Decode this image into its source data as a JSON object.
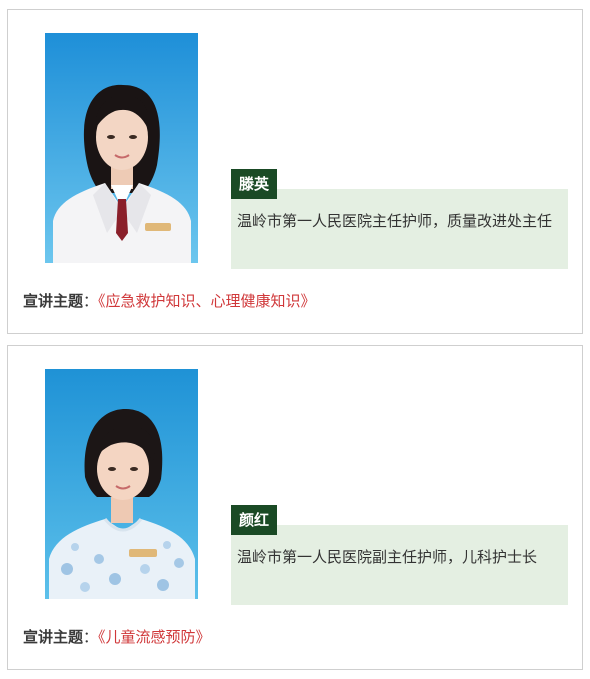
{
  "speakers": [
    {
      "photo_icon": "portrait-nurse-icon",
      "name": "滕英",
      "title": "温岭市第一人民医院主任护师，质量改进处主任",
      "topic_label": "宣讲主题",
      "topic_colon": "：",
      "topic": "《应急救护知识、心理健康知识》"
    },
    {
      "photo_icon": "portrait-nurse-icon",
      "name": "颜红",
      "title": "温岭市第一人民医院副主任护师，儿科护士长",
      "topic_label": "宣讲主题",
      "topic_colon": "：",
      "topic": "《儿童流感预防》"
    }
  ],
  "colors": {
    "name_tag_bg": "#1a4a25",
    "desc_bg": "#e4efe2",
    "topic_accent": "#d0383a",
    "photo_bg": "#2aa3e0"
  }
}
